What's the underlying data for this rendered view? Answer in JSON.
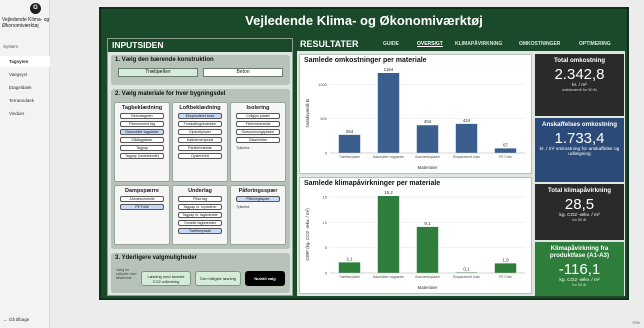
{
  "nav": {
    "logo_glyph": "G",
    "app_title": "Vejledende Klima- og Økonomiværktøj",
    "section": "System",
    "items": [
      "Tagsyten",
      "Vaegsyst",
      "Etageldaek",
      "Terraendaek",
      "Vinduer"
    ],
    "active_index": 0,
    "back_label": "Gå tilbage"
  },
  "title": "Vejledende Klima- og Økonomiværktøj",
  "inputs": {
    "header": "INPUTSIDEN",
    "step1": {
      "title": "1. Vælg den bærende konstruktion",
      "options": [
        "Træbjælker",
        "Beton"
      ],
      "selected": 0
    },
    "step2": {
      "title": "2. Vælg materiale for hver bygningsdel",
      "slicers": [
        {
          "title": "Tagbeklædning",
          "items": [
            "Betontagsten",
            "Fibercement tag",
            "Naturskifer tagplader",
            "Ståltagplader",
            "Tagpap",
            "Tagpap (vedvarende)"
          ],
          "selected": 2
        },
        {
          "title": "Loftbeklædning",
          "items": [
            "Ekspanderet koks",
            "Forskallingsbrædder",
            "Gipsloftplader",
            "Kalkcementpuds",
            "Pantlerbrædde",
            "Dysterbrett"
          ],
          "selected": 0
        },
        {
          "title": "Isolering",
          "items": [
            "Cellgips plader",
            "Fibermineraluld",
            "Glasroekningspiader",
            "Glasmelder"
          ],
          "selected": -1,
          "note": "Tykkelse"
        },
        {
          "title": "Dampspærre",
          "items": [
            "Aluminiumsfolie",
            "PE Folie"
          ],
          "selected": 1
        },
        {
          "title": "Underlag",
          "items": [
            "Pillar-lag",
            "Tagpap m. krydsfiner",
            "Tagpap m. tagbrædde",
            "Tomidte tagbrædder",
            "Træfiberplade"
          ],
          "selected": 4
        },
        {
          "title": "Påforingsspær",
          "items": [
            "Påforingsspær"
          ],
          "selected": 0,
          "note": "Tykkelse"
        }
      ]
    },
    "step3": {
      "title": "3. Yderligere valgmuligheder",
      "note": "Vælg en udbyder med tilhørende",
      "buttons": [
        "Løsning med laveste CO2 udledning",
        "Den billigste løsning",
        "Nulstil valg"
      ]
    }
  },
  "results": {
    "header": "RESULTATER",
    "tabs": [
      "GUIDE",
      "OVERSIGT",
      "KLIMAPÅVIRKNING",
      "OMKOSTNINGER",
      "OPTIMERING"
    ],
    "active_tab": 1
  },
  "chart_data": [
    {
      "type": "bar",
      "title": "Samlede omkostninger per materiale",
      "ylabel": "Nutidsværdi kr",
      "xlabel": "Materialer",
      "categories": [
        "Træfiberplade",
        "Naturskifer tagplader",
        "Glasmeldsplader",
        "Ekspanderet koks",
        "PE Folie"
      ],
      "values": [
        264,
        1164,
        404,
        424,
        67
      ],
      "ylim": [
        0,
        1000
      ],
      "yticks": [
        0,
        500,
        1000
      ],
      "color": "#3a5f8f"
    },
    {
      "type": "bar",
      "title": "Samlede klimapåvirkninger per materiale",
      "ylabel": "GWP (kg. CO2 -ækv. / m²)",
      "xlabel": "Materialer",
      "categories": [
        "Træfiberplade",
        "Naturskifer tagplader",
        "Glasmeldsplader",
        "Ekspanderet koks",
        "PE Folie"
      ],
      "values": [
        2.1,
        15.2,
        9.1,
        0.1,
        1.9
      ],
      "ylim": [
        0,
        15
      ],
      "yticks": [
        0,
        5,
        10,
        15
      ],
      "color": "#2f7d3a"
    }
  ],
  "kpis": [
    {
      "title": "Total omkostning",
      "value": "2.342,8",
      "unit": "kr. / m²",
      "sub": "nutidsværdi for 50 år",
      "style": "dark"
    },
    {
      "title": "Anskaffelses omkostning",
      "value": "1.733,4",
      "unit": "kr. / m² omkostning for anskaffelse og udlægning",
      "sub": "",
      "style": "blue"
    },
    {
      "title": "Total klimapåvirkning",
      "value": "28,5",
      "unit": "kg. CO2 -ækv. / m²",
      "sub": "for 50 år",
      "style": "dark"
    },
    {
      "title": "Klimapåvirkning fra produktfase (A1-A3)",
      "value": "-116,1",
      "unit": "kg. CO2 -ækv. / m²",
      "sub": "for 50 år",
      "style": "green"
    }
  ],
  "zoom": "70%"
}
